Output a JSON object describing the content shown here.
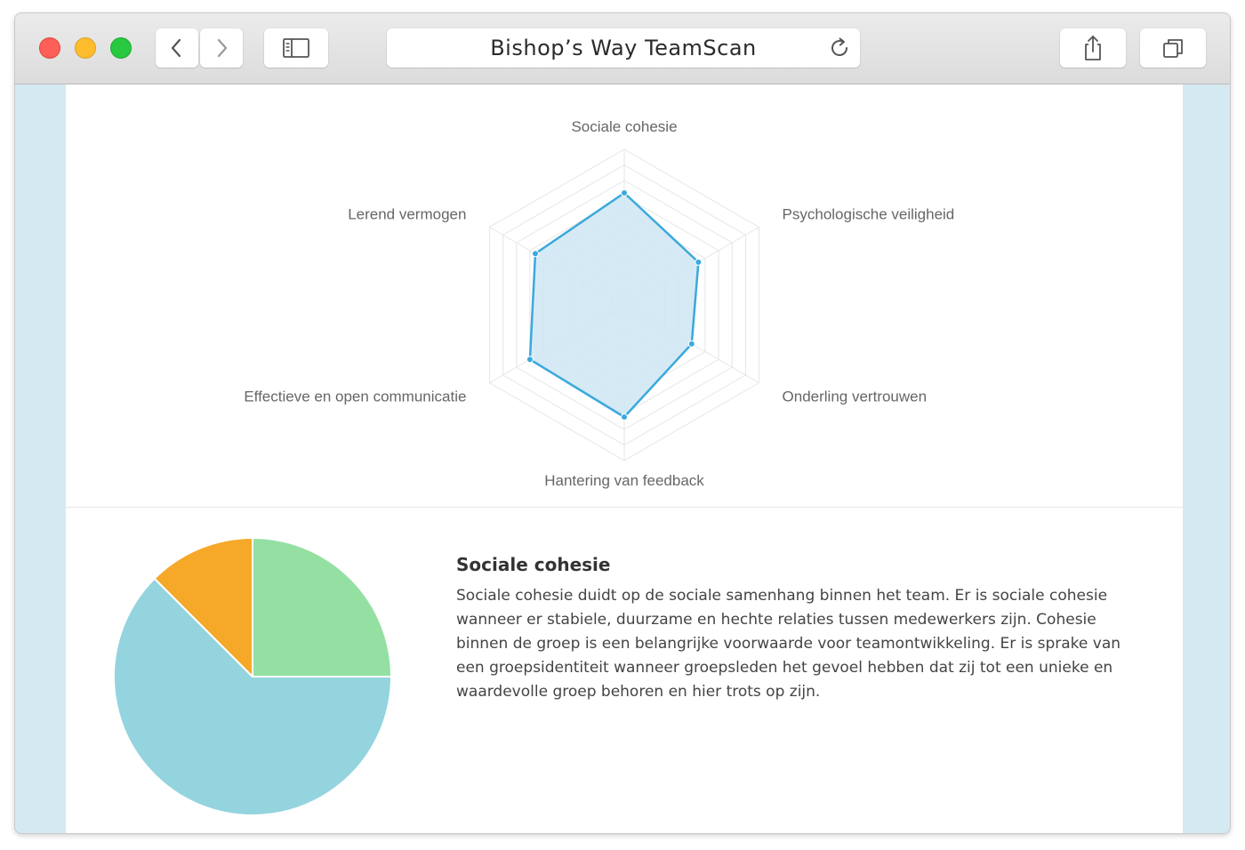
{
  "browser": {
    "title": "Bishop’s Way TeamScan",
    "icons": [
      "back-chevron-icon",
      "forward-chevron-icon",
      "sidebar-icon",
      "reload-icon",
      "share-icon",
      "tabs-icon"
    ]
  },
  "colors": {
    "radar_line": "#3aa9dc",
    "radar_fill": "#cfe6f4",
    "grid": "#e6e6e6",
    "pie_green": "#94e0a3",
    "pie_blue": "#94d4de",
    "pie_orange": "#f6a829",
    "page_bg": "#d5e9f2"
  },
  "chart_data": [
    {
      "type": "radar",
      "categories": [
        "Sociale cohesie",
        "Psychologische veiligheid",
        "Onderling vertrouwen",
        "Hantering van feedback",
        "Effectieve en open communicatie",
        "Lerend vermogen"
      ],
      "values": [
        7.2,
        5.5,
        5.0,
        7.2,
        7.0,
        6.6
      ],
      "rmax": 10,
      "grid_levels": 10,
      "grid": true,
      "legend": "none"
    },
    {
      "type": "pie",
      "slices": [
        {
          "color": "#94e0a3",
          "value": 25
        },
        {
          "color": "#94d4de",
          "value": 62.5
        },
        {
          "color": "#f6a829",
          "value": 12.5
        }
      ],
      "start": "top",
      "direction": "clockwise"
    }
  ],
  "description": {
    "title": "Sociale cohesie",
    "lines": [
      "Sociale cohesie duidt op de sociale samenhang binnen het team. Er is sociale cohesie",
      "wanneer er stabiele, duurzame en hechte relaties tussen medewerkers zijn. Cohesie",
      "binnen de groep is een belangrijke voorwaarde voor teamontwikkeling. Er is sprake van",
      "een groepsidentiteit wanneer groepsleden het gevoel hebben dat zij tot een unieke en",
      "waardevolle groep behoren en hier trots op zijn."
    ]
  }
}
